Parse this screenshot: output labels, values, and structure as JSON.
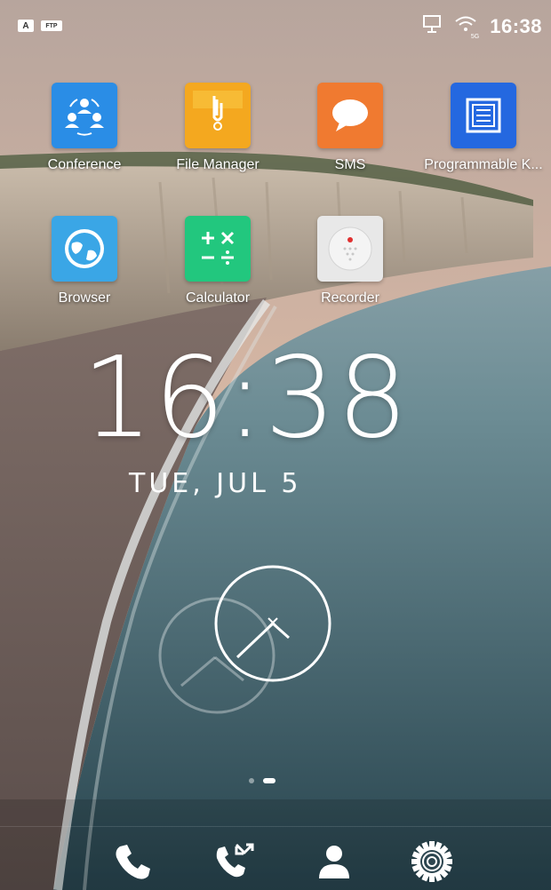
{
  "status_bar": {
    "left_badges": [
      "A",
      "FTP"
    ],
    "icons": [
      "network-icon",
      "wifi-icon"
    ],
    "wifi_label": "5G",
    "time": "16:38"
  },
  "apps": [
    {
      "label": "Conference",
      "icon": "conference-icon",
      "color": "#2a8de6"
    },
    {
      "label": "File Manager",
      "icon": "file-manager-icon",
      "color": "#f4a81f"
    },
    {
      "label": "SMS",
      "icon": "sms-icon",
      "color": "#f07a30"
    },
    {
      "label": "Programmable K...",
      "icon": "programmable-keys-icon",
      "color": "#2468e0"
    },
    {
      "label": "Browser",
      "icon": "browser-icon",
      "color": "#3aa6e6"
    },
    {
      "label": "Calculator",
      "icon": "calculator-icon",
      "color": "#22c77e"
    },
    {
      "label": "Recorder",
      "icon": "recorder-icon",
      "color": "#e8e8e8"
    }
  ],
  "clock": {
    "time": "16:38",
    "date": "TUE, JUL 5"
  },
  "page_indicator": {
    "pages": 2,
    "active": 2
  },
  "dock": [
    {
      "name": "phone",
      "icon": "phone-icon"
    },
    {
      "name": "call-history",
      "icon": "call-history-icon"
    },
    {
      "name": "contacts",
      "icon": "contact-icon"
    },
    {
      "name": "settings",
      "icon": "settings-gear-icon"
    }
  ]
}
